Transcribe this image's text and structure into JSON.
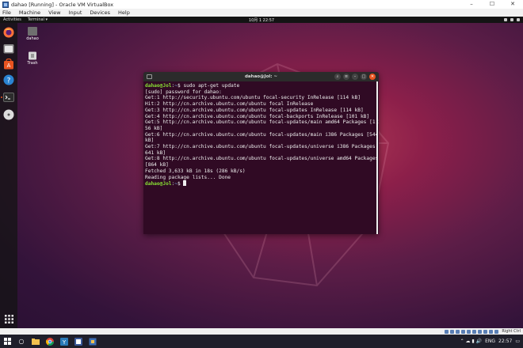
{
  "vbox": {
    "title": "dahao [Running] - Oracle VM VirtualBox",
    "menu": [
      "File",
      "Machine",
      "View",
      "Input",
      "Devices",
      "Help"
    ],
    "host_key": "Right Ctrl"
  },
  "gnome": {
    "activities": "Activities",
    "app_menu": "Terminal ▾",
    "clock": "10月 1 22:57"
  },
  "desktop_icons": [
    {
      "label": "dahao"
    },
    {
      "label": "Trash"
    }
  ],
  "terminal": {
    "title": "dahao@Jol: ~",
    "prompt_user": "dahao@Jol",
    "prompt_sep": ":",
    "prompt_path": "~",
    "prompt_symbol": "$",
    "command": " sudo apt-get update",
    "output": [
      "[sudo] password for dahao:",
      "Get:1 http://security.ubuntu.com/ubuntu focal-security InRelease [114 kB]",
      "Hit:2 http://cn.archive.ubuntu.com/ubuntu focal InRelease",
      "Get:3 http://cn.archive.ubuntu.com/ubuntu focal-updates InRelease [114 kB]",
      "Get:4 http://cn.archive.ubuntu.com/ubuntu focal-backports InRelease [101 kB]",
      "Get:5 http://cn.archive.ubuntu.com/ubuntu focal-updates/main amd64 Packages [1,2",
      "56 kB]",
      "Get:6 http://cn.archive.ubuntu.com/ubuntu focal-updates/main i386 Packages [544",
      "kB]",
      "Get:7 http://cn.archive.ubuntu.com/ubuntu focal-updates/universe i386 Packages [",
      "641 kB]",
      "Get:8 http://cn.archive.ubuntu.com/ubuntu focal-updates/universe amd64 Packages",
      "[864 kB]",
      "Fetched 3,633 kB in 18s (286 kB/s)",
      "Reading package lists... Done"
    ]
  },
  "taskbar": {
    "language": "ENG",
    "time": "22:57"
  },
  "colors": {
    "ubuntu_orange": "#e95420",
    "terminal_bg": "#300a24",
    "prompt_green": "#8ae234",
    "prompt_blue": "#729fcf"
  }
}
